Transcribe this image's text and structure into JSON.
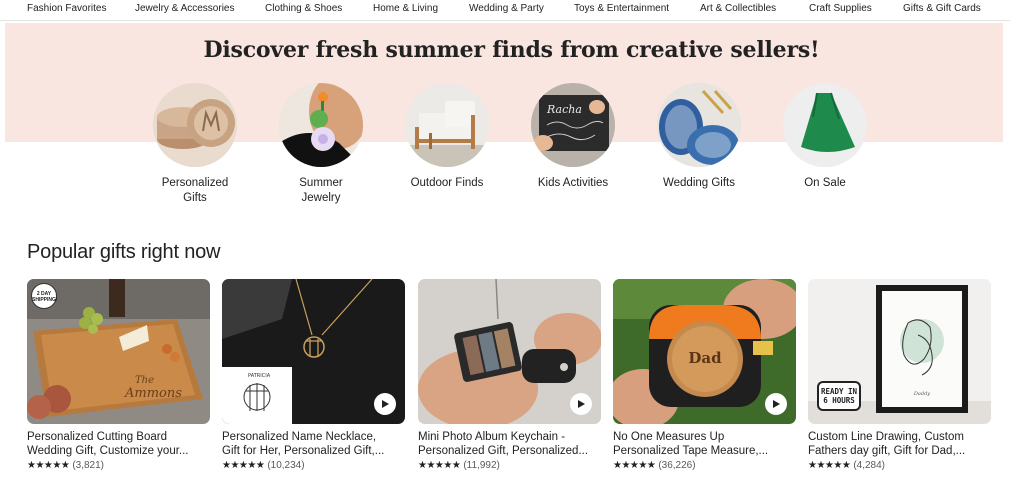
{
  "top_nav": [
    "Fashion Favorites",
    "Jewelry & Accessories",
    "Clothing & Shoes",
    "Home & Living",
    "Wedding & Party",
    "Toys & Entertainment",
    "Art & Collectibles",
    "Craft Supplies",
    "Gifts & Gift Cards"
  ],
  "hero": {
    "title": "Discover fresh summer finds from creative sellers!",
    "background_color": "#fae6e0"
  },
  "categories": [
    {
      "label": "Personalized Gifts",
      "line1": "Personalized",
      "line2": "Gifts"
    },
    {
      "label": "Summer Jewelry",
      "line1": "Summer",
      "line2": "Jewelry"
    },
    {
      "label": "Outdoor Finds",
      "line1": "Outdoor Finds",
      "line2": ""
    },
    {
      "label": "Kids Activities",
      "line1": "Kids Activities",
      "line2": ""
    },
    {
      "label": "Wedding Gifts",
      "line1": "Wedding Gifts",
      "line2": ""
    },
    {
      "label": "On Sale",
      "line1": "On Sale",
      "line2": ""
    }
  ],
  "popular": {
    "title": "Popular gifts right now",
    "products": [
      {
        "title_line1": "Personalized Cutting Board",
        "title_line2": "Wedding Gift, Customize your...",
        "stars": "★★★★★",
        "count": "(3,821)",
        "badge": "2 DAY SHIPPING!",
        "has_video": false
      },
      {
        "title_line1": "Personalized Name Necklace,",
        "title_line2": "Gift for Her, Personalized Gift,...",
        "stars": "★★★★★",
        "count": "(10,234)",
        "has_video": true
      },
      {
        "title_line1": "Mini Photo Album Keychain -",
        "title_line2": "Personalized Gift, Personalized...",
        "stars": "★★★★★",
        "count": "(11,992)",
        "has_video": true
      },
      {
        "title_line1": "No One Measures Up",
        "title_line2": "Personalized Tape Measure,...",
        "stars": "★★★★★",
        "count": "(36,226)",
        "tape_text": "Dad",
        "has_video": true
      },
      {
        "title_line1": "Custom Line Drawing, Custom",
        "title_line2": "Fathers day gift, Gift for Dad,...",
        "stars": "★★★★★",
        "count": "(4,284)",
        "ready_text": "READY IN 6 HOURS",
        "has_video": false
      }
    ]
  },
  "icons": {
    "play": "play-icon",
    "star": "star-icon"
  },
  "colors": {
    "text": "#222222",
    "muted": "#595959",
    "hero_bg": "#fae6e0",
    "sale_bag": "#1e8a4c"
  }
}
